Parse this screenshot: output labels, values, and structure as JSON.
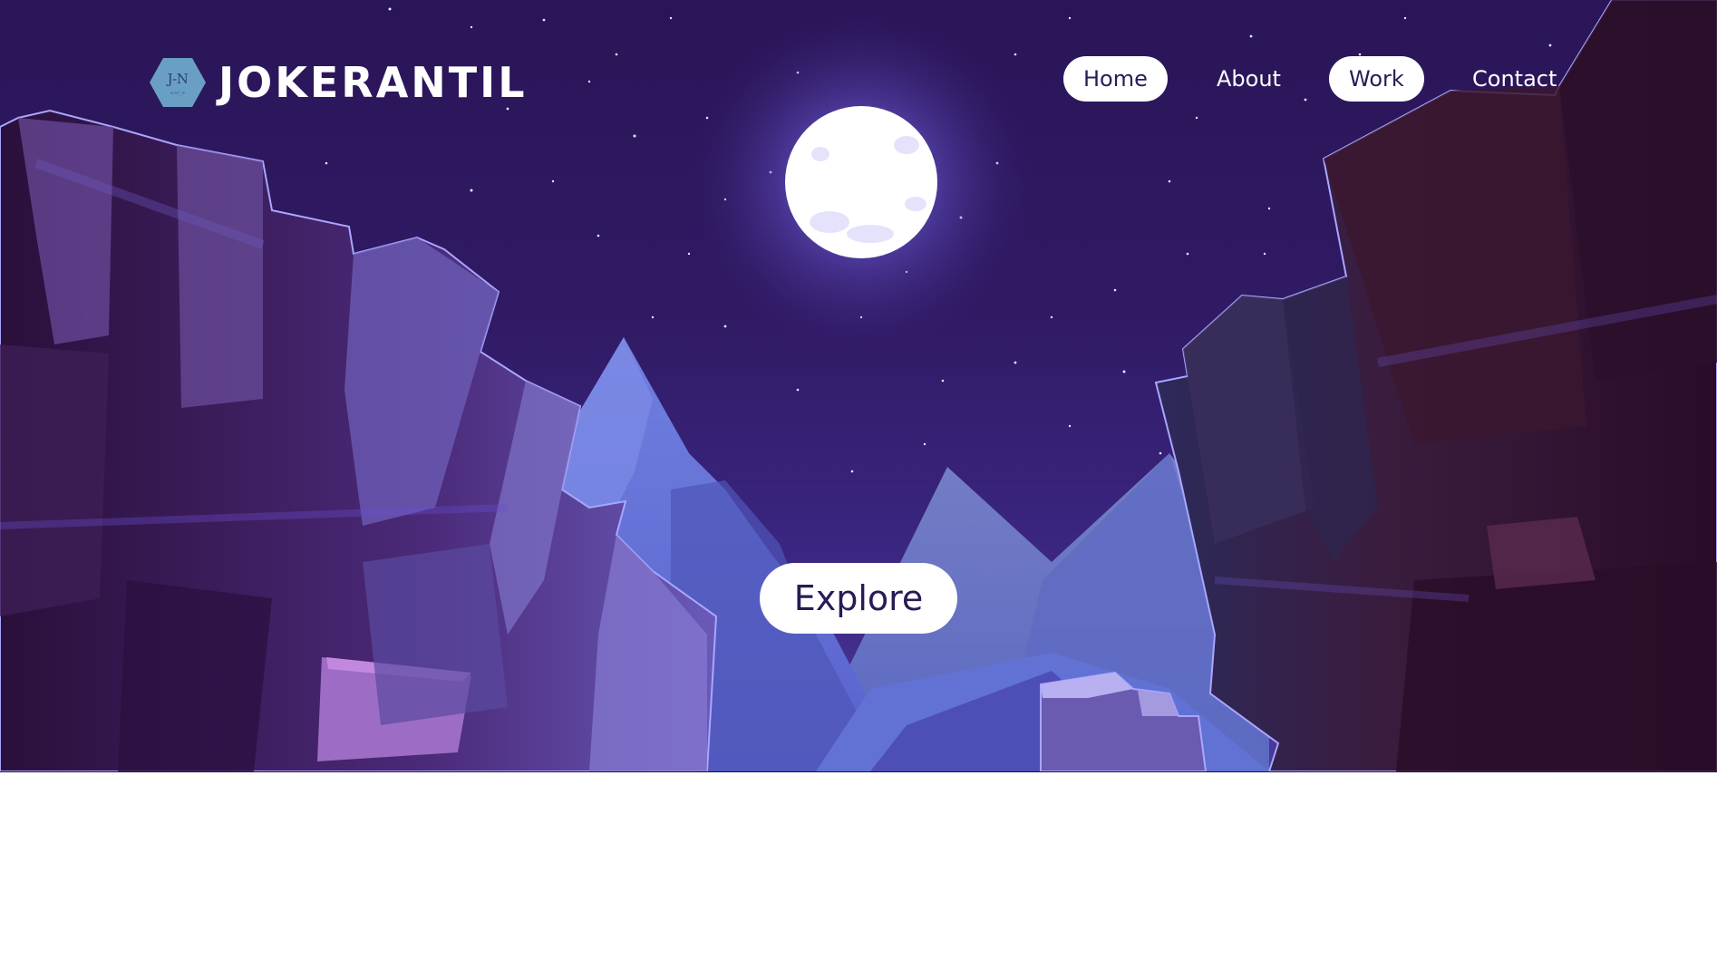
{
  "brand": {
    "initials": "J-N",
    "badge_subtext": "<>/_>",
    "name": "JOKERANTIL",
    "badge_color": "#6a9fc4"
  },
  "nav": {
    "items": [
      {
        "label": "Home",
        "active": true
      },
      {
        "label": "About",
        "active": false
      },
      {
        "label": "Work",
        "active": true
      },
      {
        "label": "Contact",
        "active": false
      }
    ]
  },
  "hero": {
    "cta_label": "Explore",
    "sky_color": "#2d1860",
    "moon_color": "#ffffff",
    "mountain_color": "#6d73d6",
    "cliff_color": "#3a2050"
  }
}
